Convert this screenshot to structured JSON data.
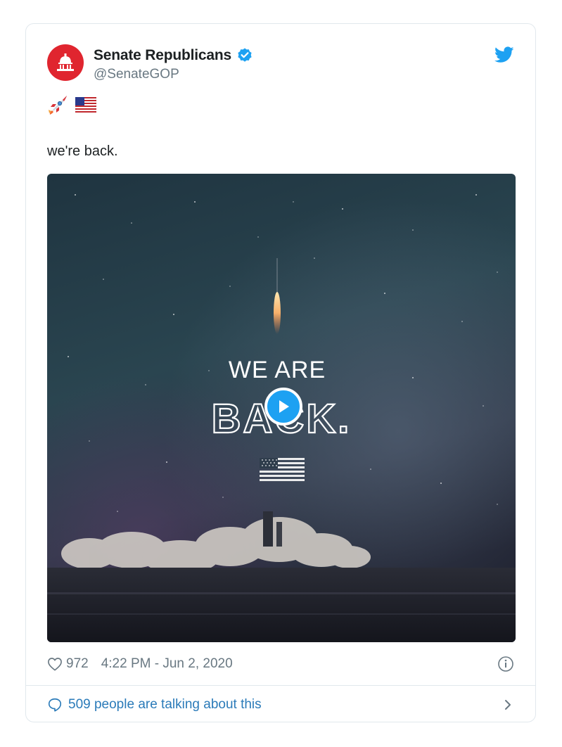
{
  "account": {
    "name": "Senate Republicans",
    "handle": "@SenateGOP",
    "verified": true,
    "avatar_color": "#e0252f"
  },
  "tweet": {
    "emojis": [
      "rocket-emoji",
      "us-flag-emoji"
    ],
    "text": "we're back."
  },
  "media": {
    "type": "video",
    "overlay_line1": "WE ARE",
    "overlay_line2": "BACK."
  },
  "footer": {
    "like_count": "972",
    "timestamp": "4:22 PM - Jun 2, 2020",
    "talking": "509 people are talking about this"
  },
  "colors": {
    "link": "#2b7bb9",
    "twitter_blue": "#1da1f2",
    "muted": "#697882"
  }
}
